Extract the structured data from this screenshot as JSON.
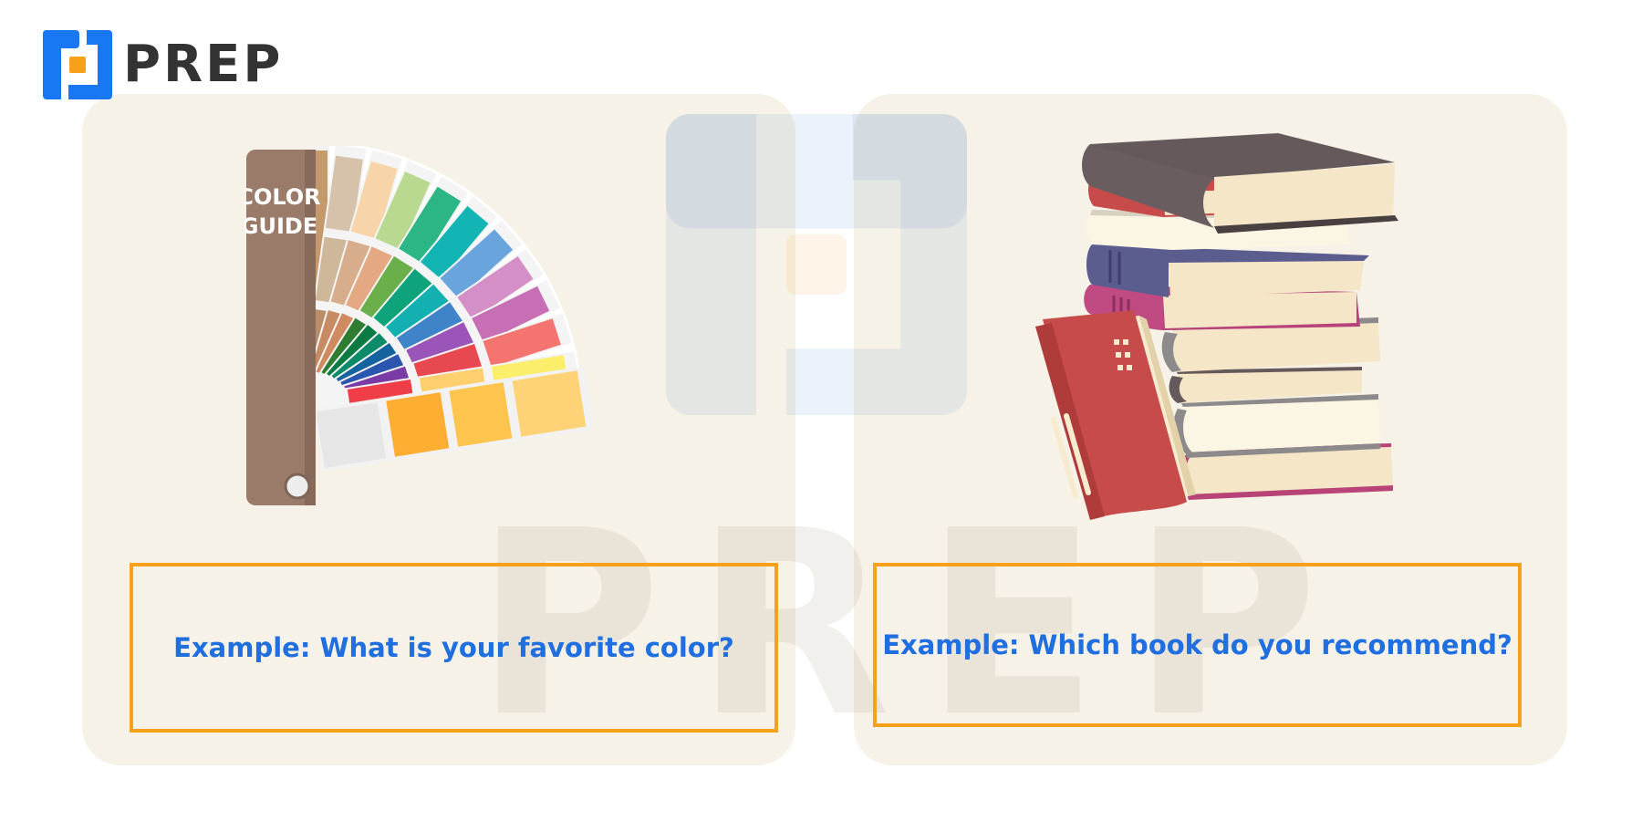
{
  "brand": {
    "name": "PREP",
    "icon": "prep-logo-icon",
    "colors": {
      "blue": "#1877f2",
      "orange": "#f7a11a",
      "text": "#333333"
    }
  },
  "watermark": {
    "text": "PREP"
  },
  "cards": [
    {
      "illustration": {
        "icon": "color-guide-swatch-fan-icon",
        "label_line1": "COLOR",
        "label_line2": "GUIDE"
      },
      "example": "Example: What is your favorite color?"
    },
    {
      "illustration": {
        "icon": "book-stack-icon"
      },
      "example": "Example: Which book do you recommend?"
    }
  ],
  "colors": {
    "card_bg": "#f7f2e7",
    "box_border": "#f7a11a",
    "example_text": "#1f6fe0"
  }
}
